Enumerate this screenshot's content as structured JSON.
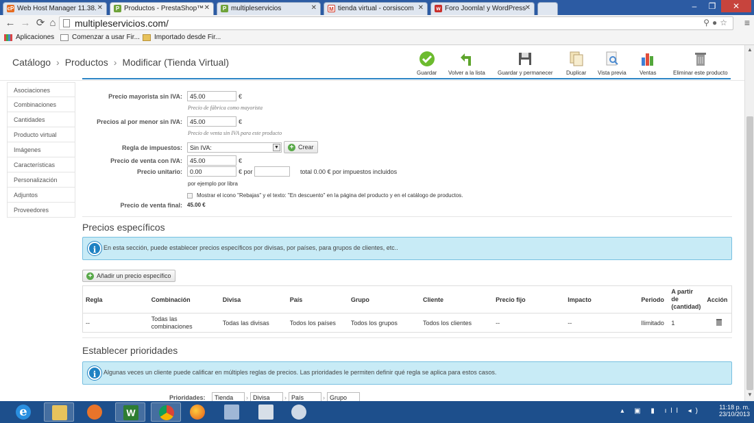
{
  "browser": {
    "tabs": [
      {
        "title": "Web Host Manager 11.38.",
        "icon": "cpanel-icon",
        "active": false
      },
      {
        "title": "Productos - PrestaShop™",
        "icon": "prestashop-icon",
        "active": true
      },
      {
        "title": "multipleservicios",
        "icon": "prestashop-icon",
        "active": false
      },
      {
        "title": "tienda virtual - corsiscom",
        "icon": "gmail-icon",
        "active": false
      },
      {
        "title": "Foro Joomla! y WordPress",
        "icon": "forum-icon",
        "active": false
      }
    ],
    "url": "multipleservicios.com/",
    "bookmarks": [
      "Aplicaciones",
      "Comenzar a usar Fir...",
      "Importado desde Fir..."
    ]
  },
  "header": {
    "breadcrumb": [
      "Catálogo",
      "Productos",
      "Modificar (Tienda Virtual)"
    ],
    "toolbar": [
      {
        "label": "Guardar",
        "icon": "checkmark-icon"
      },
      {
        "label": "Volver a la lista",
        "icon": "back-arrow-icon"
      },
      {
        "label": "Guardar y permanecer",
        "icon": "floppy-disk-icon"
      },
      {
        "label": "Duplicar",
        "icon": "duplicate-icon"
      },
      {
        "label": "Vista previa",
        "icon": "preview-icon"
      },
      {
        "label": "Ventas",
        "icon": "bar-chart-icon"
      },
      {
        "label": "Eliminar este producto",
        "icon": "trash-icon"
      }
    ]
  },
  "sidebar": {
    "items": [
      "Asociaciones",
      "Combinaciones",
      "Cantidades",
      "Producto virtual",
      "Imágenes",
      "Características",
      "Personalización",
      "Adjuntos",
      "Proveedores"
    ]
  },
  "pricing": {
    "wholesale_label": "Precio mayorista sin IVA:",
    "wholesale_value": "45.00",
    "wholesale_hint": "Precio de fábrica como mayorista",
    "retail_label": "Precios al por menor sin IVA:",
    "retail_value": "45.00",
    "retail_hint": "Precio de venta sin IVA para este producto",
    "tax_label": "Regla de impuestos:",
    "tax_value": "Sin IVA:",
    "create_button": "Crear",
    "with_tax_label": "Precio de venta con IVA:",
    "with_tax_value": "45.00",
    "unit_label": "Precio unitario:",
    "unit_value": "0.00",
    "unit_per": "€ por",
    "unit_per_value": "",
    "unit_total": "total 0.00 € por impuestos incluidos",
    "unit_hint": "por ejemplo por libra",
    "currency": "€",
    "sale_checkbox": "Mostrar el icono \"Rebajas\" y el texto: \"En descuento\" en la página del producto y en el catálogo de productos.",
    "final_label": "Precio de venta final:",
    "final_value": "45.00 €"
  },
  "specific_prices": {
    "title": "Precios específicos",
    "info": "En esta sección, puede establecer precios específicos por divisas, por países, para grupos de clientes, etc..",
    "add_button": "Añadir un precio específico",
    "columns": [
      "Regla",
      "Combinación",
      "Divisa",
      "País",
      "Grupo",
      "Cliente",
      "Precio fijo",
      "Impacto",
      "Periodo",
      "A partir de (cantidad)",
      "Acción"
    ],
    "rows": [
      [
        "--",
        "Todas las combinaciones",
        "Todas las divisas",
        "Todos los países",
        "Todos los grupos",
        "Todos los clientes",
        "--",
        "--",
        "Ilimitado",
        "1"
      ]
    ]
  },
  "priorities": {
    "title": "Establecer prioridades",
    "info": "Algunas veces un cliente puede calificar en múltiples reglas de precios. Las prioridades le permiten definir qué regla se aplica para estos casos.",
    "label": "Prioridades:",
    "selects": [
      "Tienda",
      "Divisa",
      "País",
      "Grupo"
    ]
  },
  "taskbar": {
    "time": "11:18 p. m.",
    "date": "23/10/2013"
  }
}
